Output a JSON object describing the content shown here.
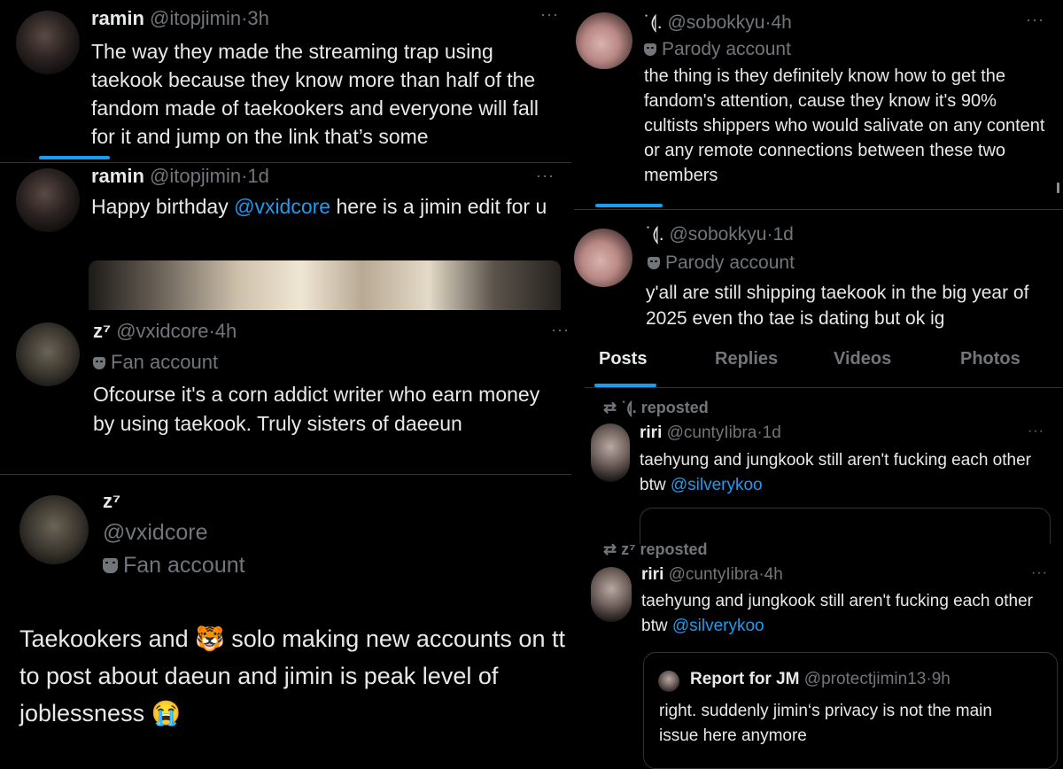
{
  "tweets": {
    "t1": {
      "name": "ramin",
      "handle": "@itopjimin",
      "time": "3h",
      "text": "The way they made the streaming trap using taekook because they know more than half of the fandom made of taekookers and everyone will fall for it and jump on the link that’s some"
    },
    "t2": {
      "name": "ramin",
      "handle": "@itopjimin",
      "time": "1d",
      "text_before": "Happy birthday ",
      "mention": "@vxidcore",
      "text_after": " here is a jimin edit for u"
    },
    "t3": {
      "name": "z⁷",
      "handle": "@vxidcore",
      "time": "4h",
      "badge": "Fan account",
      "text": "Ofcourse it's a corn addict writer who earn money by using taekook. Truly sisters of daeeun"
    },
    "t4": {
      "name": "z⁷",
      "handle": "@vxidcore",
      "badge": "Fan account",
      "text_before": "Taekookers and ",
      "emoji1": "🐯",
      "text_mid": " solo making new accounts on tt to post about daeun and jimin is peak level of joblessness ",
      "emoji2": "😭"
    },
    "t5": {
      "name": "˙⟬.",
      "handle": "@sobokkyu",
      "time": "4h",
      "badge": "Parody account",
      "text": "the thing is they definitely know how to get the fandom's attention, cause they know it's 90% cultists shippers who would salivate on any content or any remote connections between these two members"
    },
    "t6": {
      "name": "˙⟬.",
      "handle": "@sobokkyu",
      "time": "1d",
      "badge": "Parody account",
      "text": "y'all are still shipping taekook in the big year of 2025 even tho tae is dating but ok ig"
    }
  },
  "profile_tabs": [
    "Posts",
    "Replies",
    "Videos",
    "Photos"
  ],
  "reposts": {
    "r1": {
      "reposted_by": "˙⟬. reposted",
      "name": "riri",
      "handle": "@cuntyIibra",
      "time": "1d",
      "text_before": "taehyung and jungkook still aren't fucking each other btw ",
      "mention": "@silverykoo"
    },
    "r2": {
      "reposted_by": "z⁷ reposted",
      "name": "riri",
      "handle": "@cuntyIibra",
      "time": "4h",
      "text_before": "taehyung and jungkook still aren't fucking each other btw ",
      "mention": "@silverykoo",
      "quote": {
        "name": "Report for JM",
        "handle": "@protectjimin13",
        "time": "9h",
        "text": "right. suddenly jimin‘s privacy is not the main issue here anymore"
      }
    }
  },
  "ui": {
    "more": "···",
    "dot": "·",
    "retweet_icon": "⇄"
  }
}
